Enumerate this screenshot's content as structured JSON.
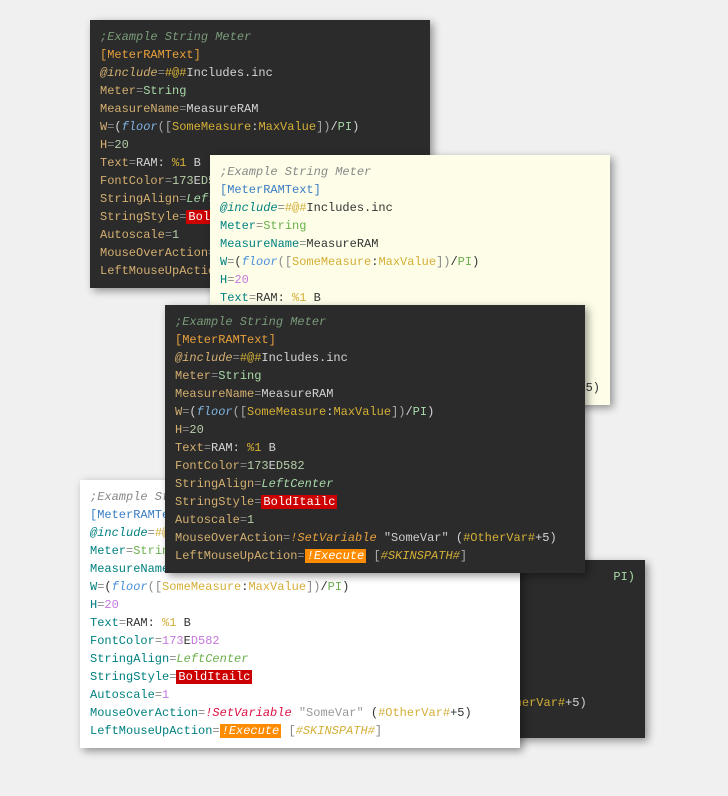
{
  "code": {
    "comment": ";Example String Meter",
    "section": "[MeterRAMText]",
    "include_key": "@include",
    "include_val1": "#@#",
    "include_val2": "Includes.inc",
    "meter_key": "Meter",
    "meter_val": "String",
    "measure_key": "MeasureName",
    "measure_val": "MeasureRAM",
    "w_key": "W",
    "w_val_pre": "(",
    "w_func": "floor",
    "w_bracket_open": "([",
    "w_somemeasure": "SomeMeasure",
    "w_colon": ":",
    "w_maxvalue": "MaxValue",
    "w_bracket_close": "])",
    "w_div": "/",
    "w_pi": "PI",
    "w_close": ")",
    "h_key": "H",
    "h_val": "20",
    "text_key": "Text",
    "text_val1": "RAM: ",
    "text_val2": "%1",
    "text_val3": " B",
    "fontcolor_key": "FontColor",
    "fontcolor_val1": "173",
    "fontcolor_val2": "E",
    "fontcolor_val3": "D582",
    "stringalign_key": "StringAlign",
    "stringalign_val": "LeftCenter",
    "stringalign_val_short": "LeftCen",
    "stringstyle_key": "StringStyle",
    "stringstyle_val": "BoldItailc",
    "stringstyle_val_short": "BoldIta",
    "autoscale_key": "Autoscale",
    "autoscale_val": "1",
    "mouseover_key": "MouseOverAction",
    "mouseover_bang": "!SetVariable",
    "mouseover_bang_short": "!Se",
    "mouseover_quoted": "\"SomeVar\"",
    "mouseover_paren_open": "(",
    "mouseover_var": "#OtherVar#",
    "mouseover_var_short": "erVar#",
    "mouseover_plus": "+5",
    "mouseover_paren_close": ")",
    "leftmouse_key": "LeftMouseUpAction",
    "leftmouse_bang": "!Execute",
    "leftmouse_bang_short": "!",
    "leftmouse_bracket_open": "[",
    "leftmouse_var": "#SKINSPATH#",
    "leftmouse_bracket_close": "]",
    "eq": "="
  },
  "partial": {
    "comment_short": ";Example S",
    "section_short": "[MeterRAM",
    "include_short": "@include=",
    "meter_short": "Meter=",
    "measure_short": "MeasureNa",
    "w_short": "W=(floor",
    "pi_close": "PI)"
  }
}
